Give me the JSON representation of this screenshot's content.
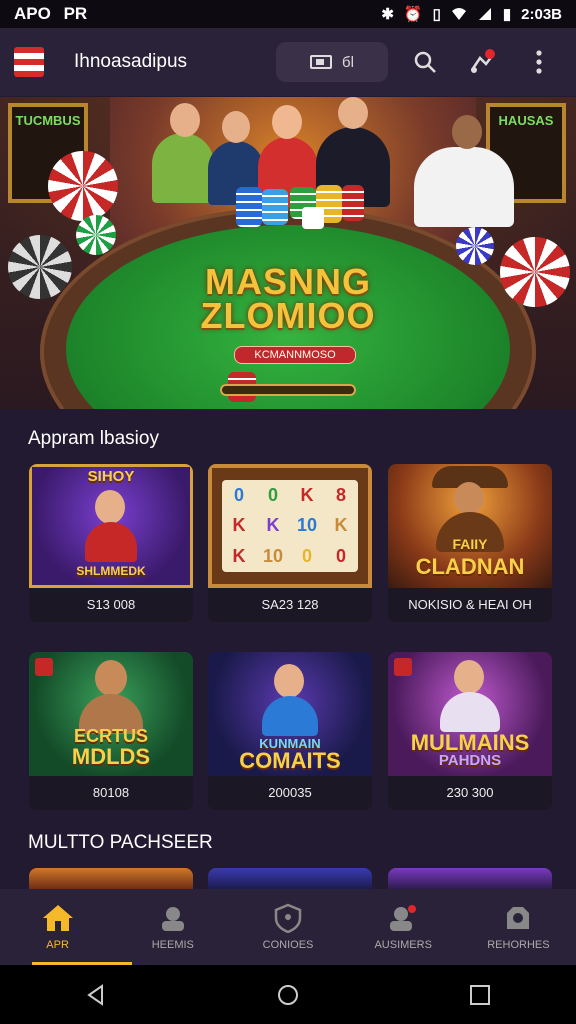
{
  "status_bar": {
    "left_text": "APO",
    "left_text2": "PR",
    "time": "2:03B"
  },
  "app_bar": {
    "title": "Ihnoasadipus",
    "pill_value": "бl"
  },
  "hero": {
    "title_line1": "MASNNG",
    "title_line2": "ZLOMIOO",
    "badge": "KCMANNMOSO",
    "left_sign": "TUCMBUS",
    "right_sign": "HAUSAS"
  },
  "sections": {
    "s1_title": "Appram lbasioy",
    "s2_title": "MULTTO PACHSEER"
  },
  "games_row1": [
    {
      "art_text": "SIHOY\nSHLMMEDK",
      "label": "S13 008"
    },
    {
      "art_text": "",
      "label": "SA23 128"
    },
    {
      "art_text": "FAIIY\nCLADNAN",
      "label": "NOKISIO & HEAI OH"
    }
  ],
  "games_row2": [
    {
      "art_text": "ECRTUS\nMDLDS",
      "label": "80108"
    },
    {
      "art_text": "KUNMAIN\nCOMAITS",
      "label": "200035"
    },
    {
      "art_text": "MULMAINS\nPAHDNS",
      "label": "230 300"
    }
  ],
  "slot_symbols": [
    [
      "0",
      "0",
      "K",
      "8"
    ],
    [
      "K",
      "K",
      "10",
      "K"
    ],
    [
      "K",
      "10",
      "0",
      "0"
    ]
  ],
  "bottom_nav": [
    {
      "label": "APR",
      "icon": "home-icon",
      "active": true
    },
    {
      "label": "HEEMIS",
      "icon": "account-icon",
      "active": false
    },
    {
      "label": "CONIOES",
      "icon": "shield-icon",
      "active": false
    },
    {
      "label": "AUSIMERS",
      "icon": "user-alert-icon",
      "active": false
    },
    {
      "label": "REHORHES",
      "icon": "profile-icon",
      "active": false
    }
  ],
  "colors": {
    "accent": "#f5b92a",
    "background": "#221a30",
    "bar": "#2a2238"
  }
}
